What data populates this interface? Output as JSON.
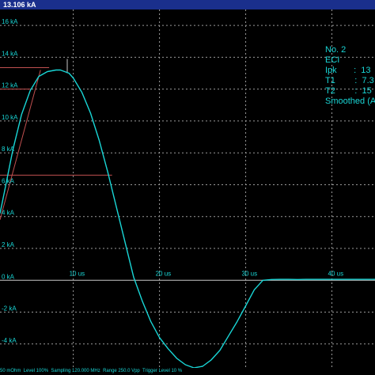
{
  "header": {
    "title": "13.106 kA"
  },
  "info_panel": {
    "lines": [
      "No. 2",
      "ECI",
      "Ipk       :  13",
      "T1        :  7.3",
      "T2        :  15",
      "Smoothed (A"
    ]
  },
  "status_bar": {
    "text": "50 mOhm  Level 100%  Sampling 120.000 MHz  Range 250.0 Vpp  Trigger Level 10 %"
  },
  "colors": {
    "background": "#000000",
    "trace": "#19d6d6",
    "grid": "#9a9a9a",
    "axis": "#c8c8c8",
    "markers": "#c05050",
    "title_bar": "#1a2f8c"
  },
  "chart_data": {
    "type": "line",
    "x_unit": "us",
    "y_unit": "kA",
    "xlim": [
      1.5,
      45
    ],
    "ylim": [
      -5.5,
      17
    ],
    "x_ticks": [
      10,
      20,
      30,
      40
    ],
    "x_tick_labels": [
      "10 us",
      "20 us",
      "30 us",
      "40 us"
    ],
    "y_ticks": [
      16,
      14,
      12,
      10,
      8,
      6,
      4,
      2,
      0,
      -2,
      -4
    ],
    "y_tick_labels": [
      "16 kA",
      "14 kA",
      "12 kA",
      "10 kA",
      "8 kA",
      "6 kA",
      "4 kA",
      "2 kA",
      "0 kA",
      "-2 kA",
      "-4 kA"
    ],
    "grid": true,
    "series": [
      {
        "x": [
          1.5,
          2,
          3,
          4,
          5,
          6,
          7,
          8,
          8.5,
          9,
          9.5,
          10,
          11,
          12,
          13,
          14,
          15,
          16,
          17,
          18,
          19,
          20,
          21,
          22,
          23,
          24,
          25,
          26,
          27,
          28,
          29,
          30,
          31,
          32,
          33,
          34,
          35,
          36,
          37,
          38,
          40,
          42,
          45
        ],
        "y": [
          4.2,
          5.5,
          8.2,
          10.4,
          11.9,
          12.8,
          13.1,
          13.2,
          13.2,
          13.1,
          13.0,
          12.7,
          11.8,
          10.5,
          8.8,
          6.8,
          4.6,
          2.4,
          0.2,
          -1.3,
          -2.6,
          -3.6,
          -4.3,
          -4.9,
          -5.3,
          -5.5,
          -5.4,
          -5.0,
          -4.4,
          -3.5,
          -2.6,
          -1.6,
          -0.6,
          0.0,
          0.05,
          0.06,
          0.06,
          0.05,
          0.06,
          0.06,
          0.06,
          0.06,
          0.06
        ]
      }
    ],
    "annotations": {
      "peak_level": 13.2,
      "level_90": 12.0,
      "level_50": 6.6,
      "front_line": {
        "x": [
          1.5,
          6.2
        ],
        "y": [
          3.8,
          13.2
        ]
      }
    }
  }
}
